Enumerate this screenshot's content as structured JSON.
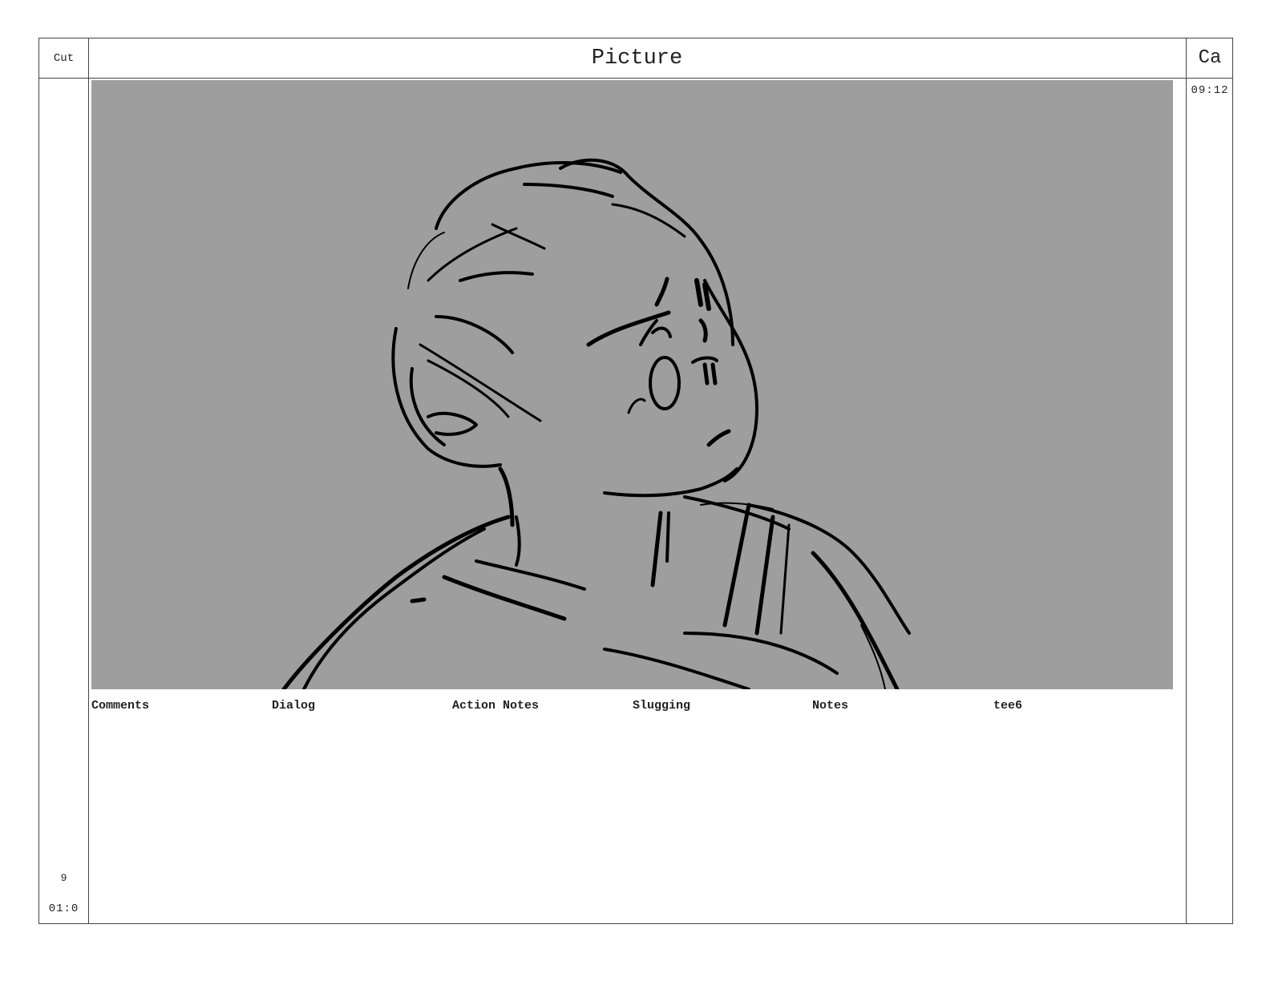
{
  "header": {
    "cut_label": "Cut",
    "picture_title": "Picture",
    "camera_label": "Ca"
  },
  "camera_column": {
    "time": "09:12"
  },
  "cut_column": {
    "scene_number": "9",
    "duration": "01:0"
  },
  "panel": {
    "background_color": "#9e9e9e",
    "sketch_description_icon": "character-sketch"
  },
  "notes_fields": [
    {
      "label": "Comments"
    },
    {
      "label": "Dialog"
    },
    {
      "label": "Action Notes"
    },
    {
      "label": "Slugging"
    },
    {
      "label": "Notes"
    },
    {
      "label": "tee6"
    }
  ]
}
